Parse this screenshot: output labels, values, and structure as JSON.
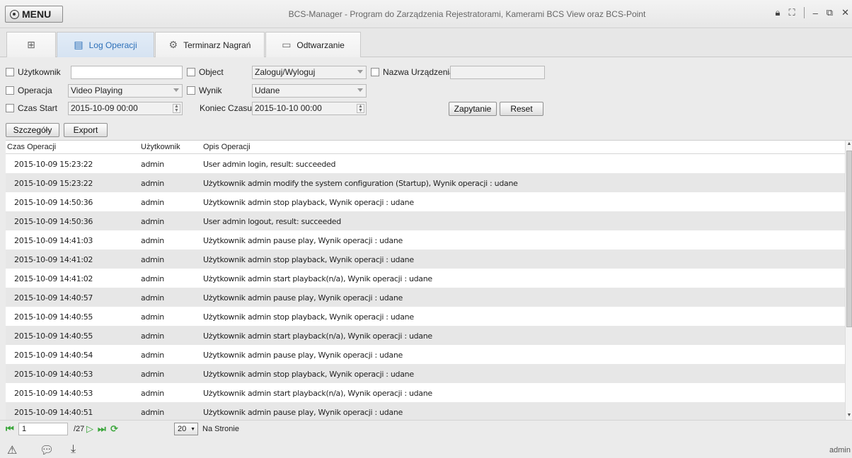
{
  "window": {
    "menu_label": "MENU",
    "title": "BCS-Manager - Program do Zarządzenia Rejestratorami, Kamerami BCS View oraz BCS-Point"
  },
  "tabs": [
    {
      "label": "",
      "icon": "grid-icon"
    },
    {
      "label": "Log Operacji",
      "icon": "log-icon",
      "active": true
    },
    {
      "label": "Terminarz Nagrań",
      "icon": "schedule-icon"
    },
    {
      "label": "Odtwarzanie",
      "icon": "playback-icon"
    }
  ],
  "filters": {
    "user_label": "Użytkownik",
    "user_value": "",
    "object_label": "Object",
    "object_value": "Zaloguj/Wyloguj",
    "device_label": "Nazwa Urządzenia",
    "device_value": "",
    "operation_label": "Operacja",
    "operation_value": "Video Playing",
    "result_label": "Wynik",
    "result_value": "Udane",
    "start_label": "Czas Start",
    "start_value": "2015-10-09 00:00",
    "end_label": "Koniec Czasu",
    "end_value": "2015-10-10 00:00",
    "query_btn": "Zapytanie",
    "reset_btn": "Reset"
  },
  "actions": {
    "details_btn": "Szczegóły",
    "export_btn": "Export"
  },
  "table": {
    "headers": [
      "Czas Operacji",
      "Użytkownik",
      "Opis Operacji"
    ],
    "rows": [
      [
        "2015-10-09 15:23:22",
        "admin",
        "User admin login, result: succeeded"
      ],
      [
        "2015-10-09 15:23:22",
        "admin",
        "Użytkownik admin modify the system configuration (Startup), Wynik operacji : udane"
      ],
      [
        "2015-10-09 14:50:36",
        "admin",
        "Użytkownik admin stop playback, Wynik operacji : udane"
      ],
      [
        "2015-10-09 14:50:36",
        "admin",
        "User admin logout, result: succeeded"
      ],
      [
        "2015-10-09 14:41:03",
        "admin",
        "Użytkownik admin pause play, Wynik operacji : udane"
      ],
      [
        "2015-10-09 14:41:02",
        "admin",
        "Użytkownik admin stop playback, Wynik operacji : udane"
      ],
      [
        "2015-10-09 14:41:02",
        "admin",
        "Użytkownik admin start playback(n/a), Wynik operacji : udane"
      ],
      [
        "2015-10-09 14:40:57",
        "admin",
        "Użytkownik admin pause play, Wynik operacji : udane"
      ],
      [
        "2015-10-09 14:40:55",
        "admin",
        "Użytkownik admin stop playback, Wynik operacji : udane"
      ],
      [
        "2015-10-09 14:40:55",
        "admin",
        "Użytkownik admin start playback(n/a), Wynik operacji : udane"
      ],
      [
        "2015-10-09 14:40:54",
        "admin",
        "Użytkownik admin pause play, Wynik operacji : udane"
      ],
      [
        "2015-10-09 14:40:53",
        "admin",
        "Użytkownik admin stop playback, Wynik operacji : udane"
      ],
      [
        "2015-10-09 14:40:53",
        "admin",
        "Użytkownik admin start playback(n/a), Wynik operacji : udane"
      ],
      [
        "2015-10-09 14:40:51",
        "admin",
        "Użytkownik admin pause play, Wynik operacji : udane"
      ]
    ]
  },
  "pager": {
    "current_page": "1",
    "total_pages": "/27",
    "per_page": "20",
    "per_page_label": "Na Stronie"
  },
  "status": {
    "user": "admin",
    "icons": [
      "warning-icon",
      "chat-icon",
      "download-icon"
    ]
  }
}
